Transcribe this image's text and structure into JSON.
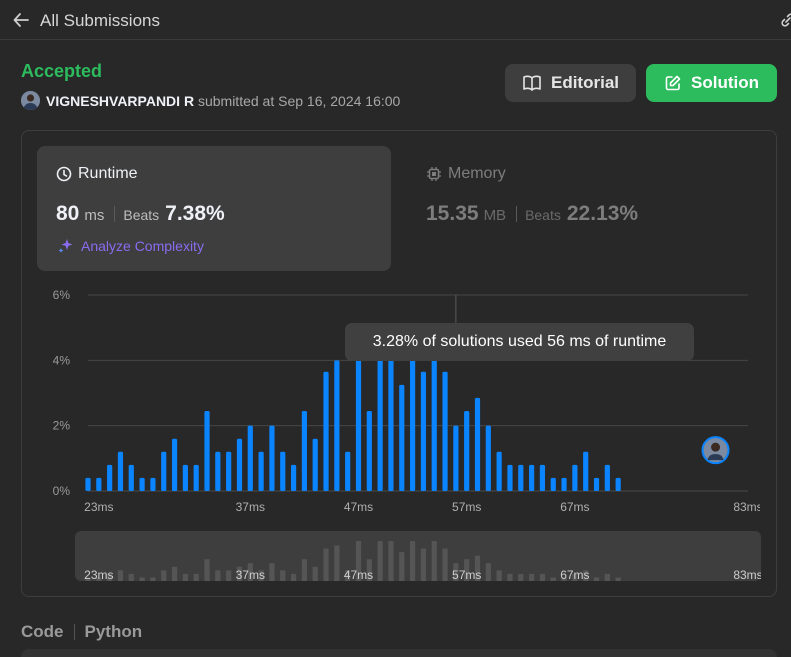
{
  "header": {
    "back_label": "All Submissions"
  },
  "submission": {
    "status": "Accepted",
    "user": "VIGNESHVARPANDI R",
    "submitted_text": "submitted at Sep 16, 2024 16:00"
  },
  "buttons": {
    "editorial": "Editorial",
    "solution": "Solution"
  },
  "runtime": {
    "title": "Runtime",
    "value": "80",
    "unit": "ms",
    "beats_label": "Beats",
    "beats_value": "7.38%",
    "analyze_label": "Analyze Complexity"
  },
  "memory": {
    "title": "Memory",
    "value": "15.35",
    "unit": "MB",
    "beats_label": "Beats",
    "beats_value": "22.13%"
  },
  "tooltip": "3.28% of solutions used 56 ms of runtime",
  "code": {
    "label": "Code",
    "language": "Python"
  },
  "colors": {
    "accent_green": "#2cbb5d",
    "bar_blue": "#0a84ff",
    "analyze_purple": "#8a6cf0",
    "mini_bar": "#555555"
  },
  "icons": {
    "back": "arrow-left-icon",
    "link": "link-icon",
    "editorial": "book-icon",
    "solution": "edit-icon",
    "runtime": "clock-icon",
    "memory": "chip-icon",
    "analyze": "sparkle-icon"
  },
  "chart_data": {
    "type": "bar",
    "ylim": [
      0,
      6
    ],
    "y_ticks": [
      "0%",
      "2%",
      "4%",
      "6%"
    ],
    "y_tick_values": [
      0,
      2,
      4,
      6
    ],
    "x_tick_labels": [
      "23ms",
      "37ms",
      "47ms",
      "57ms",
      "67ms",
      "83ms"
    ],
    "x_tick_values": [
      23,
      37,
      47,
      57,
      67,
      83
    ],
    "x": [
      22,
      23,
      24,
      25,
      26,
      27,
      28,
      29,
      30,
      31,
      32,
      33,
      34,
      35,
      36,
      37,
      38,
      39,
      40,
      41,
      42,
      43,
      44,
      45,
      46,
      47,
      48,
      49,
      50,
      51,
      52,
      53,
      54,
      55,
      56,
      57,
      58,
      59,
      60,
      61,
      62,
      63,
      64,
      65,
      66,
      67,
      68,
      69,
      70,
      71,
      72,
      73,
      74,
      75,
      76,
      77,
      78,
      79,
      80,
      81,
      82,
      83
    ],
    "values": [
      0.4,
      0.4,
      0.8,
      1.2,
      0.8,
      0.4,
      0.4,
      1.2,
      1.6,
      0.8,
      0.8,
      2.45,
      1.2,
      1.2,
      1.6,
      2.0,
      1.2,
      2.0,
      1.2,
      0.8,
      2.45,
      1.6,
      3.65,
      4.0,
      1.2,
      4.5,
      2.45,
      4.5,
      4.5,
      3.25,
      4.5,
      3.65,
      4.5,
      3.65,
      2.0,
      2.45,
      2.85,
      2.0,
      1.2,
      0.8,
      0.8,
      0.8,
      0.8,
      0.4,
      0.4,
      0.8,
      1.2,
      0.4,
      0.8,
      0.4
    ],
    "user_value_ms": 80,
    "highlight_ms": 56
  }
}
